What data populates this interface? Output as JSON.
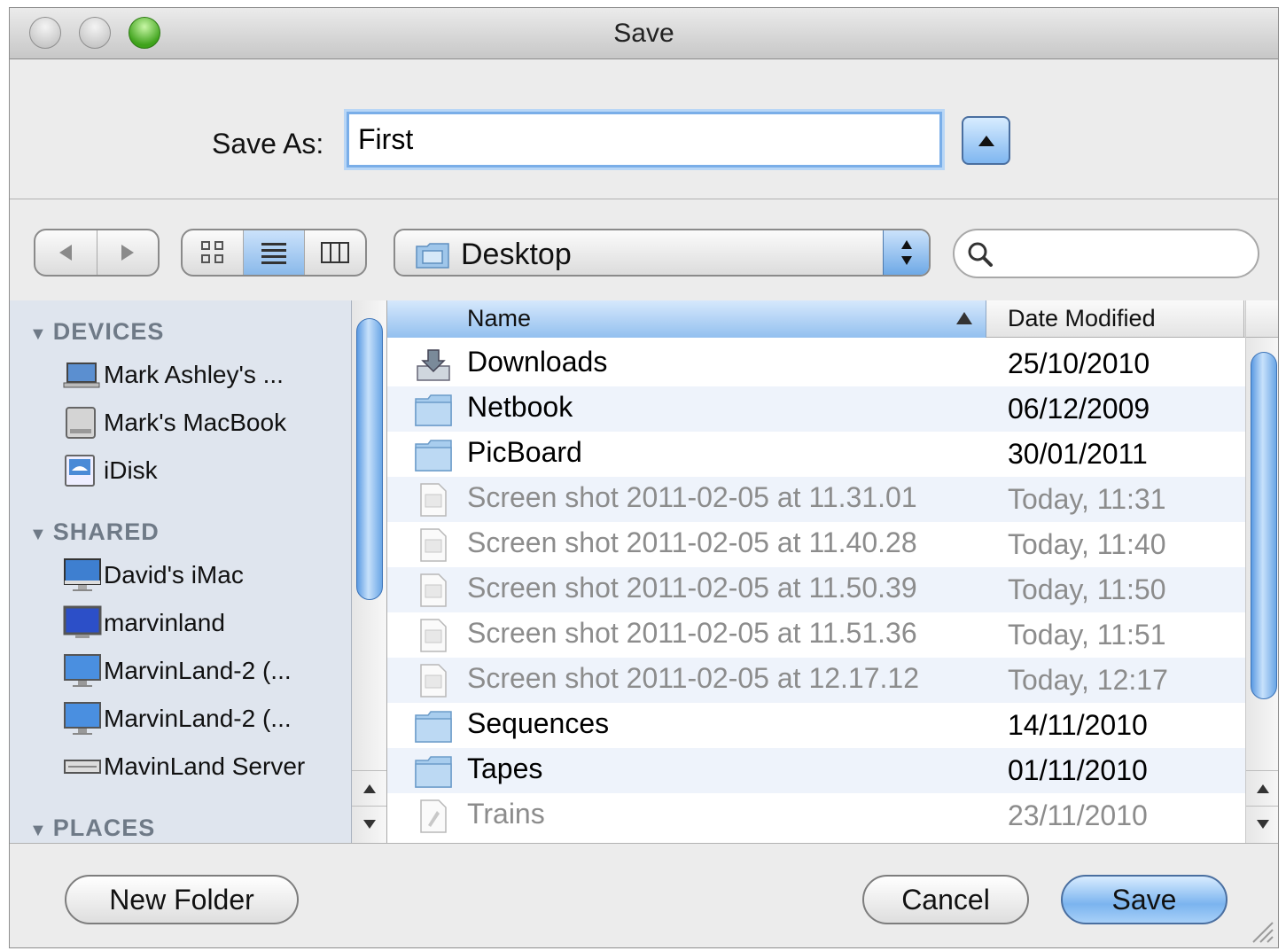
{
  "window": {
    "title": "Save"
  },
  "save_as": {
    "label": "Save As:",
    "value": "First"
  },
  "toolbar": {
    "location": "Desktop",
    "search_placeholder": ""
  },
  "sidebar": {
    "sections": [
      {
        "title": "DEVICES",
        "items": [
          {
            "label": "Mark Ashley's ...",
            "icon": "laptop-icon"
          },
          {
            "label": "Mark's MacBook",
            "icon": "hard-drive-icon"
          },
          {
            "label": "iDisk",
            "icon": "idisk-icon"
          }
        ]
      },
      {
        "title": "SHARED",
        "items": [
          {
            "label": "David's iMac",
            "icon": "imac-icon"
          },
          {
            "label": "marvinland",
            "icon": "monitor-icon"
          },
          {
            "label": "MarvinLand-2 (...",
            "icon": "monitor-icon"
          },
          {
            "label": "MarvinLand-2 (...",
            "icon": "monitor-icon"
          },
          {
            "label": "MavinLand Server",
            "icon": "server-icon"
          }
        ]
      },
      {
        "title": "PLACES",
        "items": []
      }
    ]
  },
  "file_list": {
    "columns": {
      "name": "Name",
      "date": "Date Modified"
    },
    "rows": [
      {
        "name": "Downloads",
        "date": "25/10/2010",
        "icon": "downloads-folder-icon",
        "enabled": true
      },
      {
        "name": "Netbook",
        "date": "06/12/2009",
        "icon": "folder-icon",
        "enabled": true
      },
      {
        "name": "PicBoard",
        "date": "30/01/2011",
        "icon": "folder-icon",
        "enabled": true
      },
      {
        "name": "Screen shot 2011-02-05 at 11.31.01",
        "date": "Today, 11:31",
        "icon": "image-file-icon",
        "enabled": false
      },
      {
        "name": "Screen shot 2011-02-05 at 11.40.28",
        "date": "Today, 11:40",
        "icon": "image-file-icon",
        "enabled": false
      },
      {
        "name": "Screen shot 2011-02-05 at 11.50.39",
        "date": "Today, 11:50",
        "icon": "image-file-icon",
        "enabled": false
      },
      {
        "name": "Screen shot 2011-02-05 at 11.51.36",
        "date": "Today, 11:51",
        "icon": "image-file-icon",
        "enabled": false
      },
      {
        "name": "Screen shot 2011-02-05 at 12.17.12",
        "date": "Today, 12:17",
        "icon": "image-file-icon",
        "enabled": false
      },
      {
        "name": "Sequences",
        "date": "14/11/2010",
        "icon": "folder-icon",
        "enabled": true
      },
      {
        "name": "Tapes",
        "date": "01/11/2010",
        "icon": "folder-icon",
        "enabled": true
      },
      {
        "name": "Trains",
        "date": "23/11/2010",
        "icon": "document-file-icon",
        "enabled": false
      }
    ]
  },
  "buttons": {
    "new_folder": "New Folder",
    "cancel": "Cancel",
    "save": "Save"
  },
  "colors": {
    "accent": "#7bb4ef",
    "sidebar_bg": "#dfe5ee",
    "row_alt": "#eef3fb"
  }
}
